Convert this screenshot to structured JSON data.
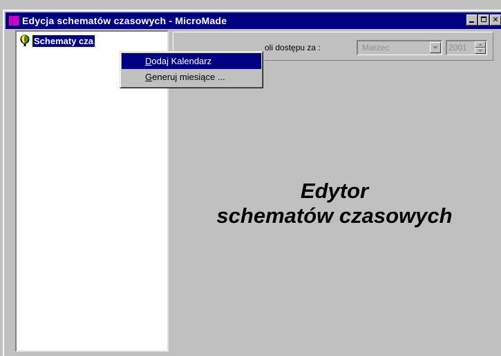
{
  "window": {
    "title": "Edycja schematów czasowych - MicroMade"
  },
  "tree": {
    "root_label": "Schematy cza"
  },
  "toolbar": {
    "access_label": "oli dostępu za :",
    "month_value": "Marzec",
    "year_value": "2001"
  },
  "main": {
    "caption_line1": "Edytor",
    "caption_line2": "schematów czasowych"
  },
  "context_menu": {
    "items": [
      {
        "mnemonic": "D",
        "rest": "odaj Kalendarz",
        "active": true
      },
      {
        "mnemonic": "G",
        "rest": "eneruj miesiące ...",
        "active": false
      }
    ]
  },
  "colors": {
    "titlebar": "#000080",
    "face": "#c0c0c0",
    "selection": "#000080"
  },
  "icons": {
    "app": "app-icon",
    "tree_root": "balloon-icon"
  }
}
